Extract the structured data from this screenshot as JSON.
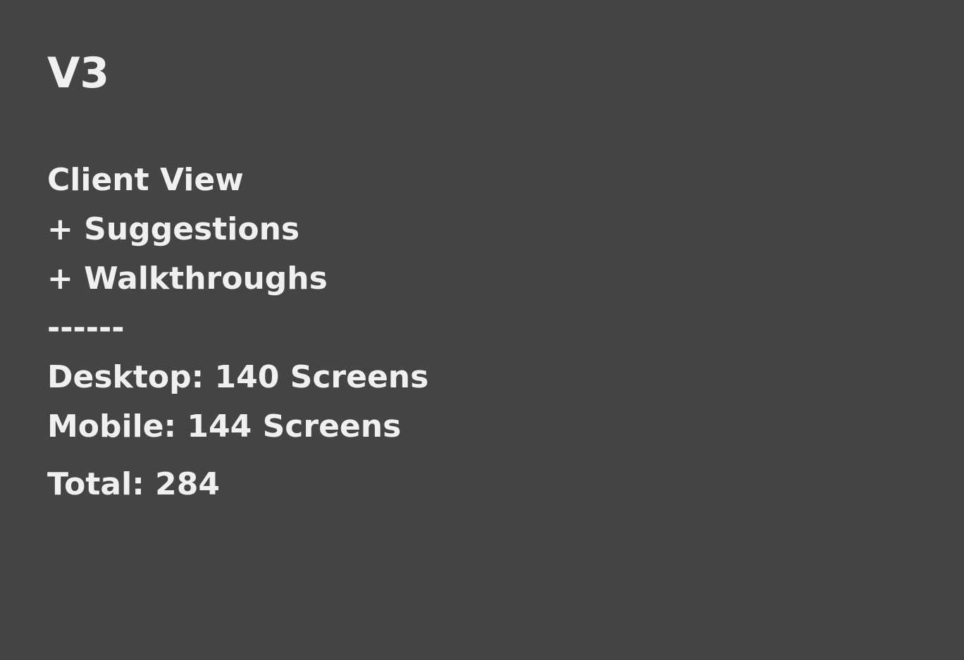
{
  "slide": {
    "title": "V3",
    "lines": [
      "Client View",
      "+ Suggestions",
      "+ Walkthroughs",
      "------",
      "Desktop: 140 Screens",
      "Mobile: 144 Screens"
    ],
    "total": "Total: 284"
  },
  "colors": {
    "background": "#444444",
    "text": "#F0F0F2"
  }
}
